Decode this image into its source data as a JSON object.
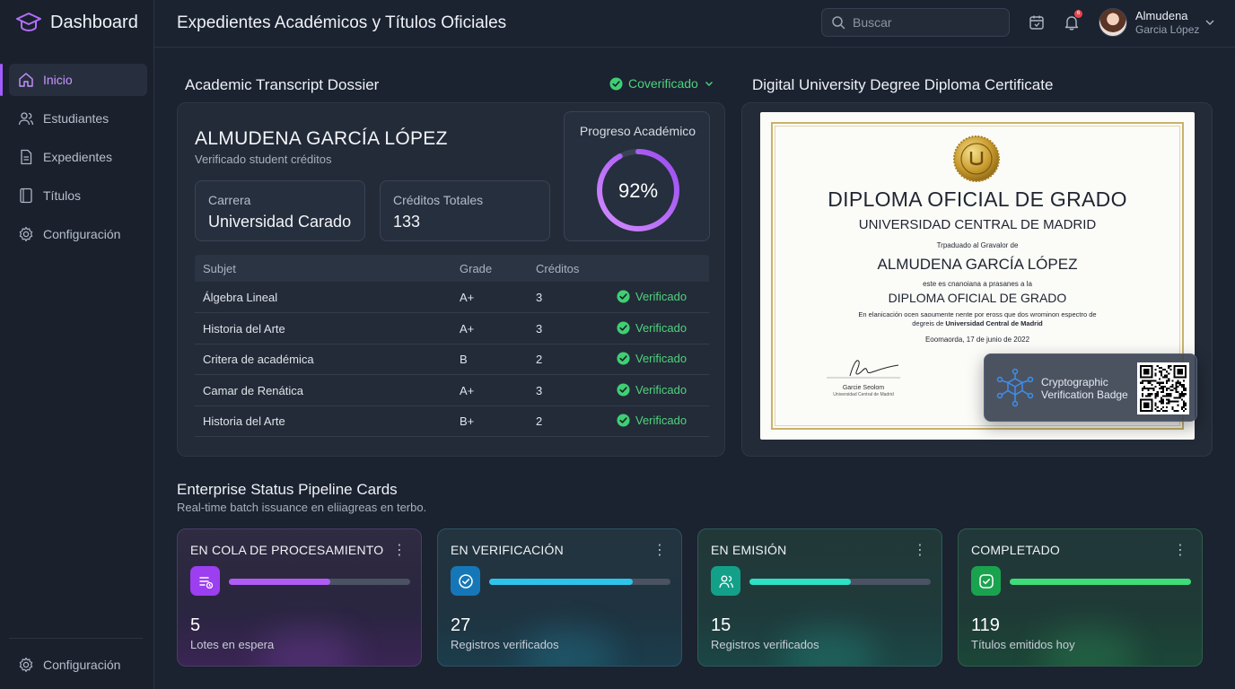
{
  "brand": {
    "title": "Dashboard"
  },
  "sidebar": {
    "items": [
      {
        "label": "Inicio",
        "icon": "home-icon",
        "active": true
      },
      {
        "label": "Estudiantes",
        "icon": "users-icon"
      },
      {
        "label": "Expedientes",
        "icon": "document-icon"
      },
      {
        "label": "Títulos",
        "icon": "certificate-icon"
      },
      {
        "label": "Configuración",
        "icon": "gear-icon"
      }
    ],
    "bottom_item": {
      "label": "Configuración",
      "icon": "gear-icon"
    }
  },
  "header": {
    "title": "Expedientes Académicos y Títulos Oficiales",
    "search_placeholder": "Buscar",
    "notification_count": "6",
    "user": {
      "name": "Almudena",
      "subtitle": "Garcia López"
    }
  },
  "transcript": {
    "section_title": "Academic Transcript Dossier",
    "status": "Coverificado",
    "student_name": "ALMUDENA GARCÍA LÓPEZ",
    "student_sub": "Verificado student créditos",
    "career": {
      "label": "Carrera",
      "value": "Universidad Carado"
    },
    "credits": {
      "label": "Créditos Totales",
      "value": "133"
    },
    "progress": {
      "label": "Progreso Académico",
      "value": "92%",
      "fraction": 0.92
    },
    "columns": [
      "Subjet",
      "Grade",
      "Créditos"
    ],
    "rows": [
      {
        "subject": "Álgebra Lineal",
        "grade": "A+",
        "credits": "3",
        "status": "Verificado"
      },
      {
        "subject": "Historia del Arte",
        "grade": "A+",
        "credits": "3",
        "status": "Verificado"
      },
      {
        "subject": "Critera de académica",
        "grade": "B",
        "credits": "2",
        "status": "Verificado"
      },
      {
        "subject": "Camar de Renática",
        "grade": "A+",
        "credits": "3",
        "status": "Verificado"
      },
      {
        "subject": "Historia del Arte",
        "grade": "B+",
        "credits": "2",
        "status": "Verificado"
      }
    ]
  },
  "diploma": {
    "section_title": "Digital University Degree Diploma Certificate",
    "heading": "DIPLOMA OFICIAL DE GRADO",
    "university": "UNIVERSIDAD CENTRAL DE MADRID",
    "line1": "Trpaduado al Gravalor de",
    "recipient": "ALMUDENA GARCÍA LÓPEZ",
    "line2": "este es cnanoiana a prasanes a la",
    "degree": "DIPLOMA OFICIAL DE GRADO",
    "line3": "En elanicación ocen saoumente nente por eross que dos wrominon espectro de",
    "line4_prefix": "degreis de ",
    "line4_bold": "Universidad Central de Madrid",
    "date": "Eoomaorda, 17 de junio de 2022",
    "signer_name": "Garcie Seolom",
    "signer_sub": "Universidad Central de Madrid",
    "badge_text": "Cryptographic Verification Badge"
  },
  "pipeline": {
    "title": "Enterprise Status Pipeline Cards",
    "subtitle": "Real-time batch issuance en eliiagreas en terbo.",
    "cards": [
      {
        "title": "EN COLA DE PROCESAMIENTO",
        "value": "5",
        "sub": "Lotes en espera",
        "progress": 0.56,
        "color": "#b05cf5",
        "icon": "queue-icon"
      },
      {
        "title": "EN VERIFICACIÓN",
        "value": "27",
        "sub": "Registros verificados",
        "progress": 0.79,
        "color": "#2ec4ea",
        "icon": "verify-icon"
      },
      {
        "title": "EN EMISIÓN",
        "value": "15",
        "sub": "Registros verificados",
        "progress": 0.56,
        "color": "#2ee0c4",
        "icon": "people-icon"
      },
      {
        "title": "COMPLETADO",
        "value": "119",
        "sub": "Títulos emitidos hoy",
        "progress": 1.0,
        "color": "#3fdc7a",
        "icon": "check-icon"
      }
    ]
  }
}
